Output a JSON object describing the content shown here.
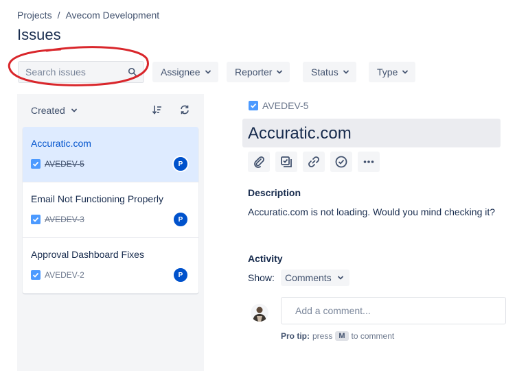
{
  "breadcrumb": {
    "items": [
      "Projects",
      "/",
      "Avecom Development"
    ]
  },
  "page_title": "Issues",
  "search": {
    "placeholder": "Search issues",
    "value": ""
  },
  "filters": [
    {
      "label": "Assignee"
    },
    {
      "label": "Reporter"
    },
    {
      "label": "Status"
    },
    {
      "label": "Type"
    }
  ],
  "list": {
    "sort_label": "Created",
    "issues": [
      {
        "title": "Accuratic.com",
        "key": "AVEDEV-5",
        "assignee_initial": "P",
        "done": true,
        "selected": true
      },
      {
        "title": "Email Not Functioning Properly",
        "key": "AVEDEV-3",
        "assignee_initial": "P",
        "done": true,
        "selected": false
      },
      {
        "title": "Approval Dashboard Fixes",
        "key": "AVEDEV-2",
        "assignee_initial": "P",
        "done": false,
        "selected": false
      }
    ]
  },
  "detail": {
    "key": "AVEDEV-5",
    "title": "Accuratic.com",
    "actions": [
      "attach-icon",
      "subtask-icon",
      "link-icon",
      "check-circle-icon",
      "more-icon"
    ],
    "description_label": "Description",
    "description": "Accuratic.com is not loading. Would you mind checking it?",
    "activity_label": "Activity",
    "show_label": "Show:",
    "show_value": "Comments",
    "comment_placeholder": "Add a comment...",
    "pro_tip_prefix": "Pro tip:",
    "pro_tip_press": "press",
    "pro_tip_key": "M",
    "pro_tip_suffix": "to comment"
  },
  "colors": {
    "accent": "#0052cc",
    "selected_bg": "#deebff",
    "panel_bg": "#f4f5f7",
    "annotation": "#d9262b",
    "checkbox": "#4c9aff"
  }
}
